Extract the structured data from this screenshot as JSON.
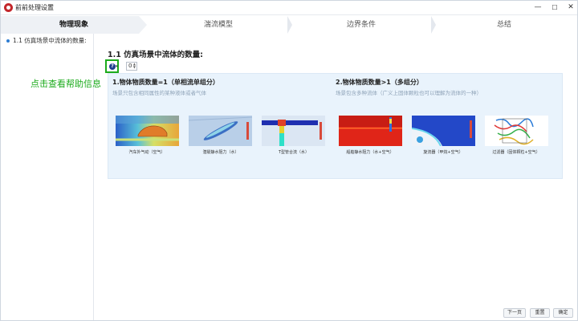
{
  "window": {
    "title": "前前处理设置",
    "minimize": "—",
    "maximize": "☐",
    "close": "✕"
  },
  "steps": [
    {
      "label": "物理现象",
      "active": true
    },
    {
      "label": "湍流模型",
      "active": false
    },
    {
      "label": "边界条件",
      "active": false
    },
    {
      "label": "总结",
      "active": false
    }
  ],
  "tree": {
    "items": [
      {
        "label": "1.1 仿真场景中流体的数量:"
      }
    ]
  },
  "help_tip": "点击查看帮助信息",
  "section": {
    "title": "1.1 仿真场景中流体的数量:",
    "help_icon": "?",
    "quantity_value": "0"
  },
  "cards": {
    "single": {
      "heading": "1.物体物质数量=1（单相流单组分）",
      "subtitle": "场景只包含相同属性的某种液体或者气体",
      "examples": [
        {
          "caption": "汽车外气动（空气）",
          "icon": "car-aero-image"
        },
        {
          "caption": "潜艇静水阻力（水）",
          "icon": "submarine-image"
        },
        {
          "caption": "T型管合流（水）",
          "icon": "t-pipe-image"
        }
      ]
    },
    "multi": {
      "heading": "2.物体物质数量>1（多组分）",
      "subtitle": "场景包含多种流体（广义上固体颗粒也可以理解为流体的一种）",
      "examples": [
        {
          "caption": "船舶静水阻力（水+空气）",
          "icon": "ship-resistance-image"
        },
        {
          "caption": "旋流器（甲烷+空气）",
          "icon": "cyclone-image"
        },
        {
          "caption": "过滤器（固体颗粒+空气）",
          "icon": "filter-image"
        }
      ]
    }
  },
  "footer": {
    "next": "下一页",
    "reset": "重置",
    "ok": "确定"
  },
  "colors": {
    "accent_green": "#1cab1c",
    "card_bg": "#e9f3fc",
    "active_step_bg": "#eef1f5"
  }
}
